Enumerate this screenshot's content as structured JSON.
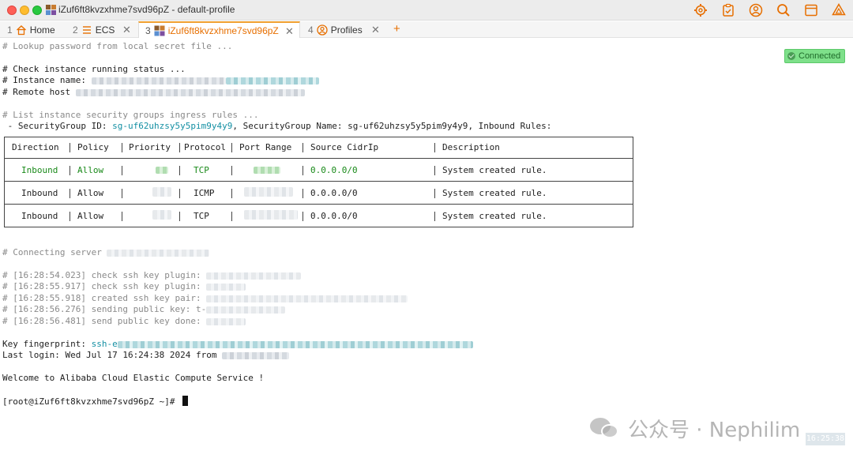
{
  "window": {
    "title": "iZuf6ft8kvzxhme7svd96pZ  - default-profile"
  },
  "tabs": [
    {
      "num": "1",
      "label": "Home",
      "icon": "home-icon"
    },
    {
      "num": "2",
      "label": "ECS",
      "icon": "server-list-icon"
    },
    {
      "num": "3",
      "label": "iZuf6ft8kvzxhme7svd96pZ",
      "icon": "instance-icon",
      "active": true
    },
    {
      "num": "4",
      "label": "Profiles",
      "icon": "profile-icon"
    }
  ],
  "status": {
    "connected": "Connected"
  },
  "terminal": {
    "lookup": "# Lookup password from local secret file ...",
    "check_status": "# Check instance running status ...",
    "instance_name_label": "# Instance name: ",
    "remote_host_label": "# Remote host ",
    "list_rules": "# List instance security groups ingress rules ...",
    "sg_prefix": " - SecurityGroup ID: ",
    "sg_id": "sg-uf62uhzsy5y5pim9y4y9",
    "sg_mid": ", SecurityGroup Name: ",
    "sg_name": "sg-uf62uhzsy5y5pim9y4y9",
    "sg_suffix": ", Inbound Rules:",
    "connecting": "# Connecting server ",
    "log1": "# [16:28:54.023] check ssh key plugin: ",
    "log2": "# [16:28:55.917] check ssh key plugin: ",
    "log3": "# [16:28:55.918] created ssh key pair: ",
    "log4_a": "# [16:28:56.276] sending public key: ",
    "log4_b": "t-",
    "log5": "# [16:28:56.481] send public key done: ",
    "fingerprint_label": "Key fingerprint: ",
    "fingerprint_value": "ssh-e",
    "last_login": "Last login: Wed Jul 17 16:24:38 2024 from ",
    "welcome": "Welcome to Alibaba Cloud Elastic Compute Service !",
    "prompt": "[root@iZuf6ft8kvzxhme7svd96pZ ~]# "
  },
  "rules_table": {
    "headers": [
      "Direction",
      "Policy",
      "Priority",
      "Protocol",
      "Port Range",
      "Source CidrIp",
      "Description"
    ],
    "rows": [
      {
        "direction": "Inbound",
        "policy": "Allow",
        "protocol": "TCP",
        "source": "0.0.0.0/0",
        "description": "System created rule."
      },
      {
        "direction": "Inbound",
        "policy": "Allow",
        "protocol": "ICMP",
        "source": "0.0.0.0/0",
        "description": "System created rule."
      },
      {
        "direction": "Inbound",
        "policy": "Allow",
        "protocol": "TCP",
        "source": "0.0.0.0/0",
        "description": "System created rule."
      }
    ]
  },
  "watermark": {
    "text": "公众号 · Nephilim",
    "time": "16:25:38"
  },
  "colors": {
    "accent": "#e76f00",
    "comment": "#8a8a8a",
    "link": "#138fa3",
    "highlight": "#1a8a1a",
    "connected": "#7ee08a"
  }
}
